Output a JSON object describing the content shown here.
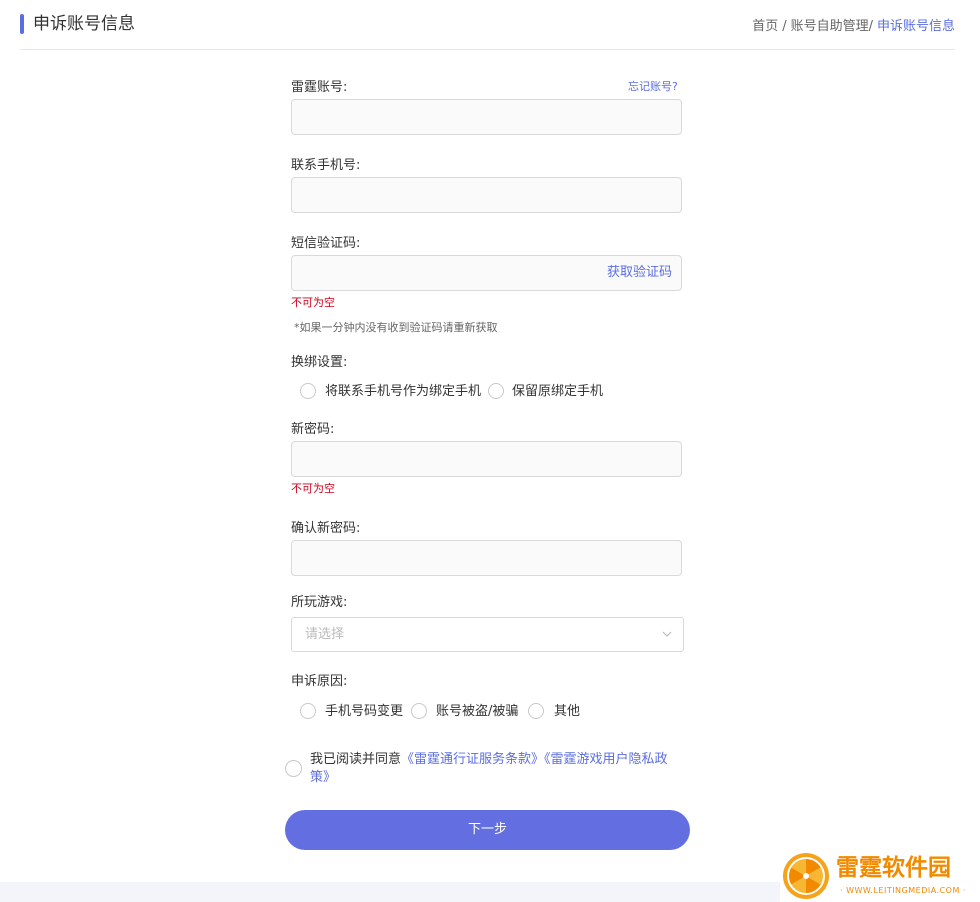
{
  "header": {
    "title": "申诉账号信息",
    "breadcrumb": {
      "home": "首页",
      "parent": "账号自助管理/",
      "current": "申诉账号信息",
      "sep": "/"
    }
  },
  "form": {
    "account_label": "雷霆账号:",
    "forgot_link": "忘记账号?",
    "phone_label": "联系手机号:",
    "sms_label": "短信验证码:",
    "get_code": "获取验证码",
    "sms_error": "不可为空",
    "sms_hint": "*如果一分钟内没有收到验证码请重新获取",
    "rebind_label": "换绑设置:",
    "rebind_options": [
      "将联系手机号作为绑定手机",
      "保留原绑定手机"
    ],
    "new_password_label": "新密码:",
    "new_password_error": "不可为空",
    "confirm_password_label": "确认新密码:",
    "game_label": "所玩游戏:",
    "game_placeholder": "请选择",
    "reason_label": "申诉原因:",
    "reason_options": [
      "手机号码变更",
      "账号被盗/被骗",
      "其他"
    ],
    "agree_prefix": "我已阅读并同意",
    "agree_link1": "《雷霆通行证服务条款》",
    "agree_link2": "《雷霆游戏用户隐私政策》",
    "next_button": "下一步"
  },
  "watermark": {
    "text": "雷霆软件园",
    "url": "· WWW.LEITINGMEDIA.COM ·"
  },
  "colors": {
    "accent": "#5b6ee1",
    "button": "#636fe0",
    "error": "#d0021b",
    "watermark": "#f28a00"
  }
}
